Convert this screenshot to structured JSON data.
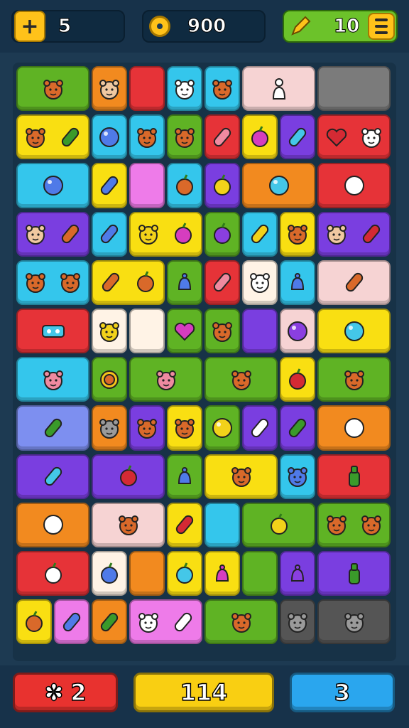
{
  "hud": {
    "moves": "5",
    "coins": "900",
    "boosters": "10"
  },
  "bottom": {
    "left_label": "2",
    "middle_label": "114",
    "right_label": "3"
  },
  "colors": {
    "green": "#5fb324",
    "orange": "#f28a1f",
    "red": "#e63338",
    "cyan": "#34c6ec",
    "pink": "#f6d3d3",
    "gray": "#7b7b7b",
    "yellow": "#f9df12",
    "purple": "#7a3ee0",
    "magenta": "#ee7be9",
    "blue": "#7d8ff0",
    "cream": "#fff3e6",
    "dark": "#555555"
  },
  "tiles": [
    {
      "c": "green",
      "icons": [
        "animal-orange-icon"
      ]
    },
    {
      "c": "orange",
      "icons": [
        "animal-cream-icon"
      ]
    },
    {
      "c": "red",
      "icons": []
    },
    {
      "c": "cyan",
      "icons": [
        "animal-white-icon"
      ]
    },
    {
      "c": "cyan",
      "icons": [
        "animal-orange-icon"
      ]
    },
    {
      "c": "pink",
      "icons": [
        "figure-white-icon"
      ]
    },
    {
      "c": "gray",
      "icons": []
    },
    {
      "c": "yellow",
      "icons": [
        "animal-orange-icon",
        "cone-green-icon"
      ]
    },
    {
      "c": "cyan",
      "icons": [
        "balloon-blue-icon"
      ]
    },
    {
      "c": "cyan",
      "icons": [
        "animal-orange-icon"
      ]
    },
    {
      "c": "green",
      "icons": [
        "animal-orange-icon"
      ]
    },
    {
      "c": "red",
      "icons": [
        "bone-pink-icon"
      ]
    },
    {
      "c": "yellow",
      "icons": [
        "fruit-magenta-icon"
      ]
    },
    {
      "c": "purple",
      "icons": [
        "crayon-cyan-icon"
      ]
    },
    {
      "c": "red",
      "icons": [
        "heart-red-icon",
        "face-white-icon"
      ]
    },
    {
      "c": "cyan",
      "icons": [
        "gem-blue-icon"
      ]
    },
    {
      "c": "yellow",
      "icons": [
        "leaf-blue-icon"
      ]
    },
    {
      "c": "magenta",
      "icons": []
    },
    {
      "c": "cyan",
      "icons": [
        "fruit-orange-icon"
      ]
    },
    {
      "c": "purple",
      "icons": [
        "pear-yellow-icon"
      ]
    },
    {
      "c": "orange",
      "icons": [
        "gem-cyan-icon"
      ]
    },
    {
      "c": "red",
      "icons": [
        "bubble-white-icon"
      ]
    },
    {
      "c": "purple",
      "icons": [
        "animal-cream-icon",
        "cone-orange-icon"
      ]
    },
    {
      "c": "cyan",
      "icons": [
        "crayon-blue-icon"
      ]
    },
    {
      "c": "yellow",
      "icons": [
        "animal-yellow-icon",
        "fruit-magenta-icon"
      ]
    },
    {
      "c": "green",
      "icons": [
        "fruit-purple-icon"
      ]
    },
    {
      "c": "cyan",
      "icons": [
        "cone-yellow-icon"
      ]
    },
    {
      "c": "yellow",
      "icons": [
        "animal-orange-icon"
      ]
    },
    {
      "c": "purple",
      "icons": [
        "animal-cream-icon",
        "bone-red-icon"
      ]
    },
    {
      "c": "cyan",
      "icons": [
        "animal-orange-icon",
        "animal-orange-icon"
      ]
    },
    {
      "c": "yellow",
      "icons": [
        "cone-orange-icon",
        "fruit-orange-icon"
      ]
    },
    {
      "c": "green",
      "icons": [
        "bell-blue-icon"
      ]
    },
    {
      "c": "red",
      "icons": [
        "bone-pink-icon"
      ]
    },
    {
      "c": "cream",
      "icons": [
        "animal-white-icon"
      ]
    },
    {
      "c": "cyan",
      "icons": [
        "bell-blue-icon"
      ]
    },
    {
      "c": "pink",
      "icons": [
        "cone-orange-icon"
      ]
    },
    {
      "c": "red",
      "icons": [
        "eyes-cyan-icon"
      ]
    },
    {
      "c": "cream",
      "icons": [
        "animal-yellow-icon"
      ]
    },
    {
      "c": "cream",
      "icons": []
    },
    {
      "c": "green",
      "icons": [
        "heart-magenta-icon"
      ]
    },
    {
      "c": "green",
      "icons": [
        "animal-orange-icon"
      ]
    },
    {
      "c": "purple",
      "icons": []
    },
    {
      "c": "pink",
      "icons": [
        "balloon-purple-icon"
      ]
    },
    {
      "c": "yellow",
      "icons": [
        "gem-cyan-icon"
      ]
    },
    {
      "c": "cyan",
      "icons": [
        "animal-pink-icon"
      ]
    },
    {
      "c": "green",
      "icons": [
        "flower-orange-icon"
      ]
    },
    {
      "c": "green",
      "icons": [
        "face-pink-icon"
      ]
    },
    {
      "c": "green",
      "icons": [
        "animal-orange-icon"
      ]
    },
    {
      "c": "yellow",
      "icons": [
        "fruit-red-icon"
      ]
    },
    {
      "c": "green",
      "icons": [
        "animal-orange-icon"
      ]
    },
    {
      "c": "blue",
      "icons": [
        "bean-green-icon"
      ]
    },
    {
      "c": "orange",
      "icons": [
        "face-gray-icon"
      ]
    },
    {
      "c": "purple",
      "icons": [
        "animal-orange-icon"
      ]
    },
    {
      "c": "yellow",
      "icons": [
        "animal-orange-icon"
      ]
    },
    {
      "c": "green",
      "icons": [
        "balloon-yellow-icon"
      ]
    },
    {
      "c": "purple",
      "icons": [
        "crayon-white-icon"
      ]
    },
    {
      "c": "purple",
      "icons": [
        "leaf-green-icon"
      ]
    },
    {
      "c": "orange",
      "icons": [
        "bubble-white-icon"
      ]
    },
    {
      "c": "purple",
      "icons": [
        "bone-cyan-icon"
      ]
    },
    {
      "c": "purple",
      "icons": [
        "fruit-red-icon"
      ]
    },
    {
      "c": "green",
      "icons": [
        "bell-blue-icon"
      ]
    },
    {
      "c": "yellow",
      "icons": [
        "animal-orange-icon"
      ]
    },
    {
      "c": "cyan",
      "icons": [
        "face-blue-icon"
      ]
    },
    {
      "c": "red",
      "icons": [
        "bottle-green-icon"
      ]
    },
    {
      "c": "orange",
      "icons": [
        "bubble-white-icon"
      ]
    },
    {
      "c": "pink",
      "icons": [
        "animal-orange-icon"
      ]
    },
    {
      "c": "yellow",
      "icons": [
        "leaf-red-icon"
      ]
    },
    {
      "c": "cyan",
      "icons": []
    },
    {
      "c": "green",
      "icons": [
        "fruit-yellow-icon"
      ]
    },
    {
      "c": "green",
      "icons": [
        "animal-orange-icon",
        "animal-orange-icon"
      ]
    },
    {
      "c": "red",
      "icons": [
        "fruit-white-icon"
      ]
    },
    {
      "c": "cream",
      "icons": [
        "fruit-blue-icon"
      ]
    },
    {
      "c": "orange",
      "icons": []
    },
    {
      "c": "yellow",
      "icons": [
        "fruit-cyan-icon"
      ]
    },
    {
      "c": "yellow",
      "icons": [
        "bell-magenta-icon"
      ]
    },
    {
      "c": "green",
      "icons": []
    },
    {
      "c": "purple",
      "icons": [
        "bell-purple-icon"
      ]
    },
    {
      "c": "purple",
      "icons": [
        "bottle-green-icon"
      ]
    },
    {
      "c": "yellow",
      "icons": [
        "fruit-orange-icon"
      ]
    },
    {
      "c": "magenta",
      "icons": [
        "crayon-blue-icon"
      ]
    },
    {
      "c": "orange",
      "icons": [
        "bean-green-icon"
      ]
    },
    {
      "c": "magenta",
      "icons": [
        "animal-white-icon",
        "crayon-white-icon"
      ]
    },
    {
      "c": "green",
      "icons": [
        "animal-orange-icon"
      ]
    },
    {
      "c": "dark",
      "icons": [
        "animal-gray-icon"
      ]
    },
    {
      "c": "dark",
      "icons": [
        "face-gray-icon"
      ]
    }
  ]
}
